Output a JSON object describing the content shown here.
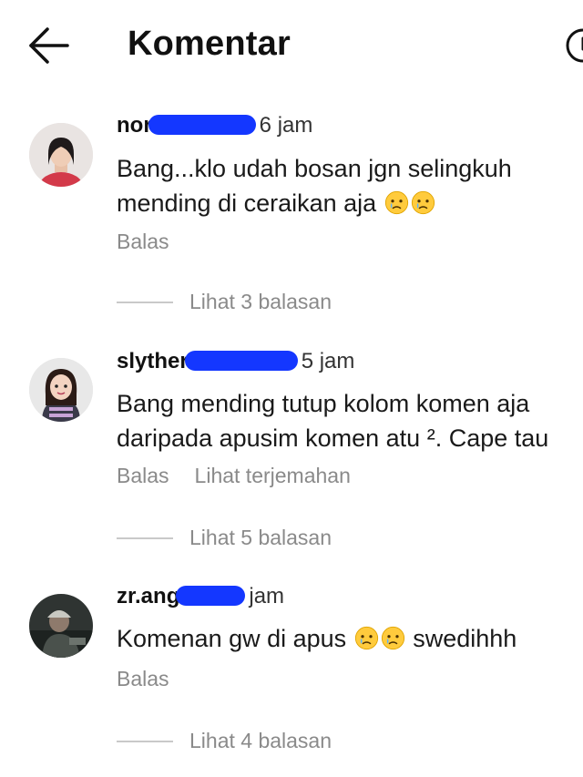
{
  "header": {
    "title": "Komentar",
    "back_icon": "arrow-left-icon",
    "right_icon": "circle-icon"
  },
  "comments": [
    {
      "username_visible": "nor",
      "time": "6 jam",
      "text_line1": "Bang...klo udah bosan jgn selingkuh",
      "text_line2": "mending di ceraikan aja",
      "emojis": [
        "crying-face-icon",
        "crying-face-icon"
      ],
      "actions": [
        "Balas"
      ],
      "replies_label": "Lihat 3 balasan"
    },
    {
      "username_visible": "slyther",
      "time": "5 jam",
      "text_line1": "Bang mending tutup kolom komen aja",
      "text_line2": "daripada apusim komen atu ². Cape tau",
      "actions": [
        "Balas",
        "Lihat terjemahan"
      ],
      "replies_label": "Lihat 5 balasan"
    },
    {
      "username_visible": "zr.ang",
      "time": "jam",
      "text_line1_before": "Komenan gw di apus",
      "text_line1_after": "swedihhh",
      "emojis": [
        "crying-face-icon",
        "crying-face-icon"
      ],
      "actions": [
        "Balas"
      ],
      "replies_label": "Lihat 4 balasan"
    }
  ],
  "colors": {
    "redaction": "#1437ff",
    "muted_text": "#8a8a8a"
  }
}
